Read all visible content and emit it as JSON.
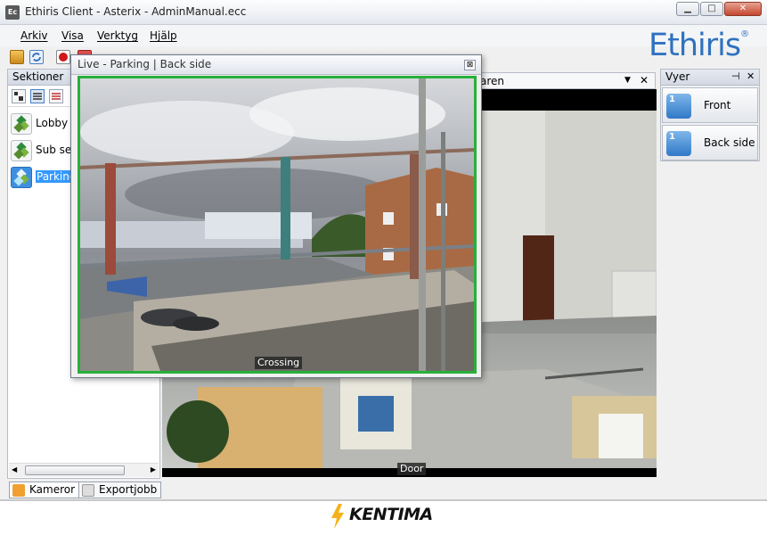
{
  "window": {
    "title": "Ethiris Client - Asterix - AdminManual.ecc",
    "app_icon_text": "Ec",
    "minimize": "▁",
    "maximize": "□",
    "close": "✕"
  },
  "menu": [
    "Arkiv",
    "Visa",
    "Verktyg",
    "Hjälp"
  ],
  "brand": {
    "logo": "Ethiris",
    "reg": "®",
    "footer": "KENTIMA"
  },
  "sections_panel": {
    "title": "Sektioner",
    "items": [
      {
        "label": "Lobby",
        "selected": false
      },
      {
        "label": "Sub sec",
        "selected": false
      },
      {
        "label": "Parking",
        "selected": true
      }
    ]
  },
  "bottom_tabs": [
    {
      "label": "Kameror"
    },
    {
      "label": "Exportjobb"
    }
  ],
  "document_tab": {
    "label": "aren",
    "dropdown": "▼",
    "close": "✕"
  },
  "main_camera": {
    "caption": "Door"
  },
  "views_panel": {
    "title": "Vyer",
    "pin": "⊣",
    "close": "✕",
    "buttons": [
      {
        "label": "Front",
        "number": "1"
      },
      {
        "label": "Back side",
        "number": "1"
      }
    ]
  },
  "floating_window": {
    "title": "Live - Parking | Back side",
    "close": "⊠",
    "caption": "Crossing"
  }
}
